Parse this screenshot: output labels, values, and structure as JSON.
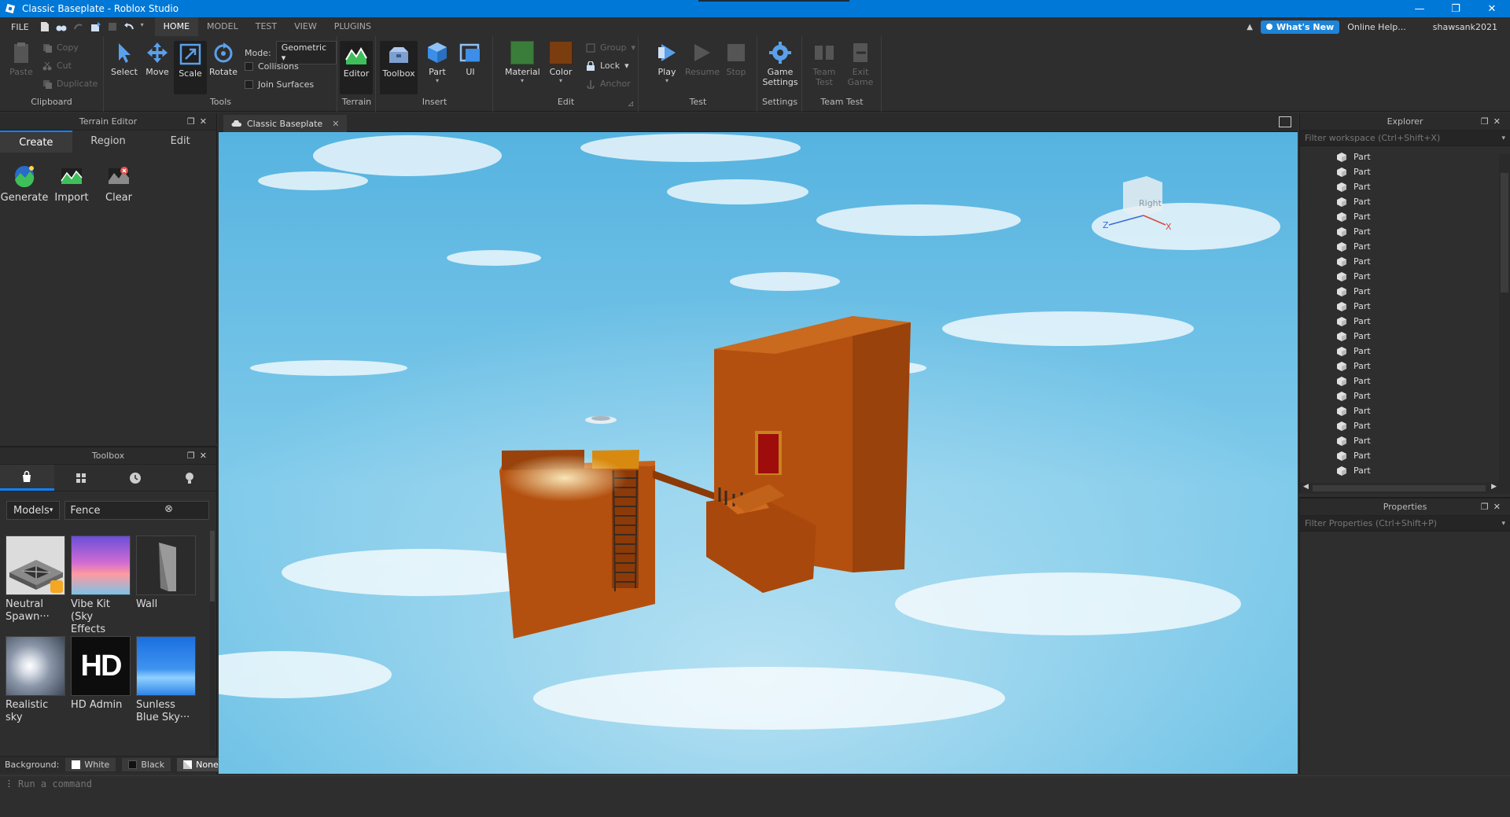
{
  "window": {
    "title": "Classic Baseplate - Roblox Studio",
    "controls": [
      "—",
      "❐",
      "✕"
    ]
  },
  "menu": {
    "file": "FILE",
    "tabs": [
      "HOME",
      "MODEL",
      "TEST",
      "VIEW",
      "PLUGINS"
    ],
    "active_tab": "HOME",
    "whats_new": "What's New",
    "online_help": "Online Help...",
    "username": "shawsank2021"
  },
  "ribbon": {
    "clipboard": {
      "label": "Clipboard",
      "paste": "Paste",
      "copy": "Copy",
      "cut": "Cut",
      "duplicate": "Duplicate"
    },
    "tools": {
      "label": "Tools",
      "select": "Select",
      "move": "Move",
      "scale": "Scale",
      "rotate": "Rotate",
      "mode_label": "Mode:",
      "mode_value": "Geometric",
      "collisions": "Collisions",
      "join_surfaces": "Join Surfaces"
    },
    "terrain": {
      "label": "Terrain",
      "editor": "Editor"
    },
    "insert": {
      "label": "Insert",
      "toolbox": "Toolbox",
      "part": "Part",
      "ui": "UI"
    },
    "edit": {
      "label": "Edit",
      "material": "Material",
      "color": "Color",
      "group": "Group",
      "lock": "Lock",
      "anchor": "Anchor"
    },
    "test": {
      "label": "Test",
      "play": "Play",
      "resume": "Resume",
      "stop": "Stop"
    },
    "settings": {
      "label": "Settings",
      "game_settings_1": "Game",
      "game_settings_2": "Settings"
    },
    "teamtest": {
      "label": "Team Test",
      "team_test_1": "Team",
      "team_test_2": "Test",
      "exit_game_1": "Exit",
      "exit_game_2": "Game"
    }
  },
  "terrain_editor": {
    "title": "Terrain Editor",
    "tabs": [
      "Create",
      "Region",
      "Edit"
    ],
    "active_tab": "Create",
    "buttons": [
      "Generate",
      "Import",
      "Clear"
    ]
  },
  "toolbox": {
    "title": "Toolbox",
    "category": "Models",
    "search_value": "Fence",
    "tiles": [
      {
        "line1": "Neutral",
        "line2": "Spawn···"
      },
      {
        "line1": "Vibe Kit (Sky",
        "line2": "Effects Only)"
      },
      {
        "line1": "Wall",
        "line2": ""
      },
      {
        "line1": "Realistic sky",
        "line2": ""
      },
      {
        "line1": "HD Admin",
        "line2": ""
      },
      {
        "line1": "Sunless",
        "line2": "Blue Sky···"
      }
    ],
    "hd_text": "HD",
    "background_label": "Background:",
    "bg_options": [
      "White",
      "Black",
      "None"
    ]
  },
  "document": {
    "tab": "Classic Baseplate",
    "view_cube_label": "Right",
    "axis_z": "Z",
    "axis_x": "X"
  },
  "explorer": {
    "title": "Explorer",
    "filter_placeholder": "Filter workspace (Ctrl+Shift+X)",
    "items": [
      "Part",
      "Part",
      "Part",
      "Part",
      "Part",
      "Part",
      "Part",
      "Part",
      "Part",
      "Part",
      "Part",
      "Part",
      "Part",
      "Part",
      "Part",
      "Part",
      "Part",
      "Part",
      "Part",
      "Part",
      "Part",
      "Part"
    ]
  },
  "properties": {
    "title": "Properties",
    "filter_placeholder": "Filter Properties (Ctrl+Shift+P)"
  },
  "command_bar": {
    "placeholder": "Run a command"
  },
  "colors": {
    "titlebar": "#0078d7",
    "accent": "#0a84ff",
    "material_green": "#3a7d3a",
    "color_brown": "#7a3d10",
    "build_orange": "#b4500f"
  }
}
